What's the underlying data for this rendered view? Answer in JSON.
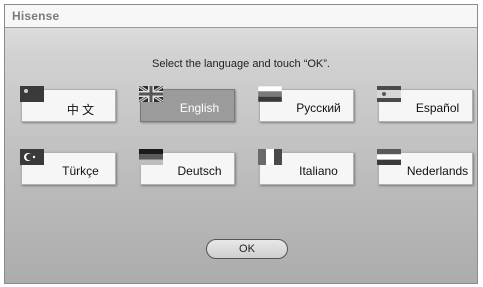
{
  "header": {
    "brand": "Hisense"
  },
  "prompt": "Select the language and touch “OK”.",
  "languages": [
    {
      "label": "中 文",
      "flag_icon": "china-flag-icon",
      "selected": false
    },
    {
      "label": "English",
      "flag_icon": "uk-flag-icon",
      "selected": true
    },
    {
      "label": "Русский",
      "flag_icon": "russia-flag-icon",
      "selected": false
    },
    {
      "label": "Español",
      "flag_icon": "spain-flag-icon",
      "selected": false
    },
    {
      "label": "Türkçe",
      "flag_icon": "turkey-flag-icon",
      "selected": false
    },
    {
      "label": "Deutsch",
      "flag_icon": "germany-flag-icon",
      "selected": false
    },
    {
      "label": "Italiano",
      "flag_icon": "italy-flag-icon",
      "selected": false
    },
    {
      "label": "Nederlands",
      "flag_icon": "netherlands-flag-icon",
      "selected": false
    }
  ],
  "ok_button": {
    "label": "OK"
  },
  "colors": {
    "selected_button": "#9b9b9b",
    "button": "#f6f6f6",
    "brand_text": "#7b7b7b"
  }
}
